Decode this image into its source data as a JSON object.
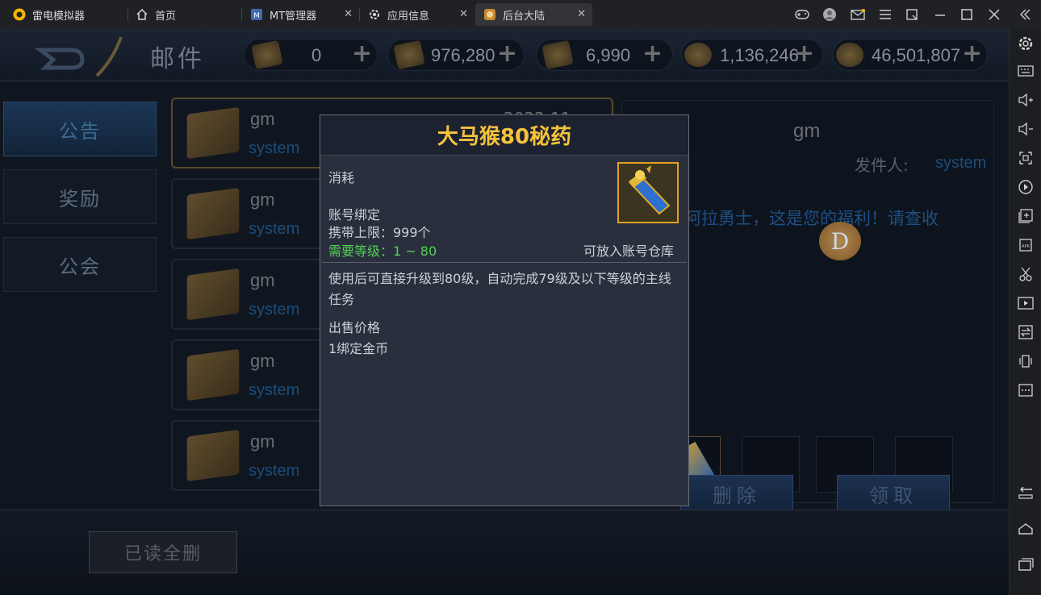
{
  "titlebar": {
    "app_name": "雷电模拟器",
    "tabs": [
      {
        "label": "首页",
        "icon": "home-icon"
      },
      {
        "label": "MT管理器",
        "icon": "mt-app-icon"
      },
      {
        "label": "应用信息",
        "icon": "gear-icon"
      },
      {
        "label": "后台大陆",
        "icon": "game-app-icon"
      }
    ],
    "close_glyph": "✕"
  },
  "game": {
    "header_title": "邮件",
    "resources": [
      {
        "value": "0"
      },
      {
        "value": "976,280"
      },
      {
        "value": "6,990"
      },
      {
        "value": "1,136,246"
      },
      {
        "value": "46,501,807"
      }
    ],
    "plus_label": "+",
    "sidebar": [
      {
        "label": "公告",
        "active": true
      },
      {
        "label": "奖励",
        "active": false
      },
      {
        "label": "公会",
        "active": false
      }
    ],
    "mails": [
      {
        "sender": "gm",
        "system": "system",
        "date": "2022-11"
      },
      {
        "sender": "gm",
        "system": "system"
      },
      {
        "sender": "gm",
        "system": "system"
      },
      {
        "sender": "gm",
        "system": "system"
      },
      {
        "sender": "gm",
        "system": "system"
      }
    ],
    "detail": {
      "title": "gm",
      "from_label": "发件人:",
      "from_value": "system",
      "body_text": "的阿拉勇士，这是您的福利！请查收",
      "delete_label": "删除",
      "claim_label": "领取",
      "coin_glyph": "D"
    },
    "read_all_delete_label": "已读全删"
  },
  "popup": {
    "title": "大马猴80秘药",
    "type_label": "消耗",
    "bind_label": "账号绑定",
    "carry_limit": "携带上限：999个",
    "required_level": "需要等级：1 ~ 80",
    "storage_note": "可放入账号仓库",
    "description": "使用后可直接升级到80级，自动完成79级及以下等级的主线任务",
    "sell_price_label": "出售价格",
    "sell_price_value": "1绑定金币"
  },
  "colors": {
    "popup_title": "#f5c33b",
    "level_green": "#51d251",
    "item_frame": "#e3a11e"
  }
}
